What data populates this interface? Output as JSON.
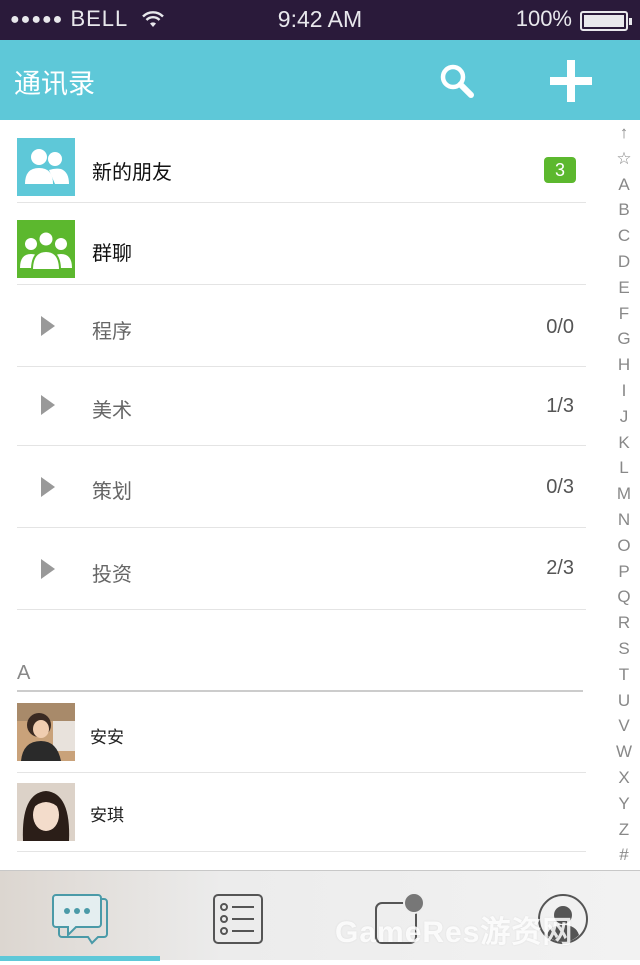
{
  "status_bar": {
    "carrier": "BELL",
    "signal_dots": "●●●●●",
    "time": "9:42 AM",
    "battery": "100%"
  },
  "nav": {
    "title": "通讯录",
    "search_icon": "search-icon",
    "add_icon": "plus-icon"
  },
  "top_items": [
    {
      "label": "新的朋友",
      "icon": "new-friends-icon",
      "icon_color": "#5ec8d8",
      "badge": "3"
    },
    {
      "label": "群聊",
      "icon": "group-chat-icon",
      "icon_color": "#5cb82e"
    }
  ],
  "groups": [
    {
      "label": "程序",
      "count": "0/0"
    },
    {
      "label": "美术",
      "count": "1/3"
    },
    {
      "label": "策划",
      "count": "0/3"
    },
    {
      "label": "投资",
      "count": "2/3"
    }
  ],
  "section": "A",
  "contacts": [
    {
      "name": "安安"
    },
    {
      "name": "安琪"
    }
  ],
  "index": [
    "↑",
    "☆",
    "A",
    "B",
    "C",
    "D",
    "E",
    "F",
    "G",
    "H",
    "I",
    "J",
    "K",
    "L",
    "M",
    "N",
    "O",
    "P",
    "Q",
    "R",
    "S",
    "T",
    "U",
    "V",
    "W",
    "X",
    "Y",
    "Z",
    "#"
  ],
  "tabs": [
    {
      "icon": "chat-bubble-icon",
      "active": true
    },
    {
      "icon": "contact-list-icon"
    },
    {
      "icon": "discover-icon"
    },
    {
      "icon": "profile-icon"
    }
  ],
  "watermark": "GameRes游资网",
  "colors": {
    "accent": "#5ec8d8",
    "badge": "#5cb82e",
    "status_bar": "#2a1a3a"
  }
}
